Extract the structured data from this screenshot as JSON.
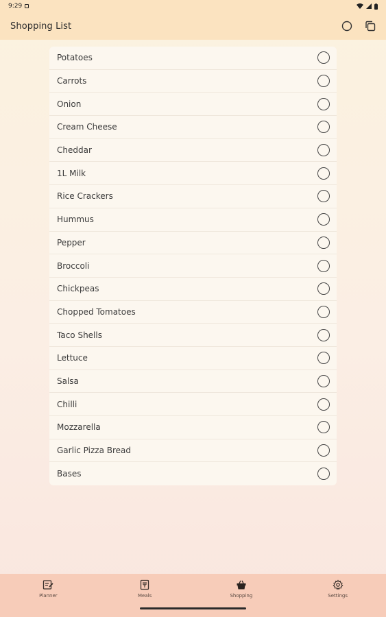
{
  "status_bar": {
    "time": "9:29"
  },
  "app_bar": {
    "title": "Shopping List"
  },
  "shopping_list": {
    "items": [
      {
        "label": "Potatoes"
      },
      {
        "label": "Carrots"
      },
      {
        "label": "Onion"
      },
      {
        "label": "Cream Cheese"
      },
      {
        "label": "Cheddar"
      },
      {
        "label": "1L Milk"
      },
      {
        "label": "Rice Crackers"
      },
      {
        "label": "Hummus"
      },
      {
        "label": "Pepper"
      },
      {
        "label": "Broccoli"
      },
      {
        "label": "Chickpeas"
      },
      {
        "label": "Chopped Tomatoes"
      },
      {
        "label": "Taco Shells"
      },
      {
        "label": "Lettuce"
      },
      {
        "label": "Salsa"
      },
      {
        "label": "Chilli"
      },
      {
        "label": "Mozzarella"
      },
      {
        "label": "Garlic Pizza Bread"
      },
      {
        "label": "Bases"
      }
    ]
  },
  "bottom_nav": {
    "items": [
      {
        "label": "Planner",
        "icon": "planner-icon"
      },
      {
        "label": "Meals",
        "icon": "meals-icon"
      },
      {
        "label": "Shopping",
        "icon": "shopping-basket-icon",
        "selected": true
      },
      {
        "label": "Settings",
        "icon": "gear-icon"
      }
    ]
  },
  "colors": {
    "app_bar": "#fbe3c0",
    "bottom_nav": "#f7ccb9",
    "card": "#fcf7ef"
  }
}
